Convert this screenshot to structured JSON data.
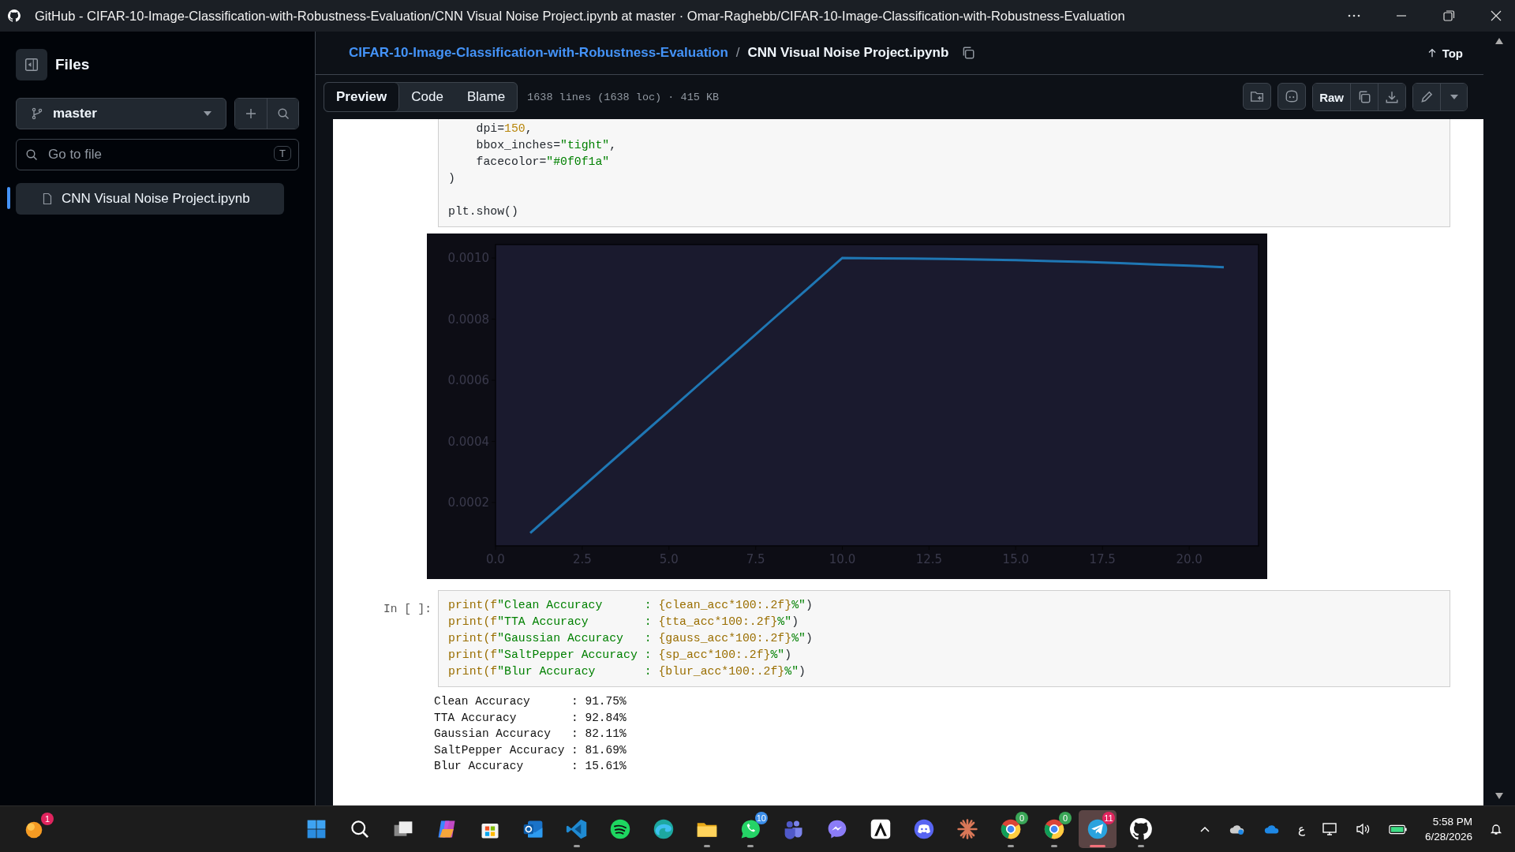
{
  "window": {
    "title": "GitHub - CIFAR-10-Image-Classification-with-Robustness-Evaluation/CNN Visual Noise Project.ipynb at master · Omar-Raghebb/CIFAR-10-Image-Classification-with-Robustness-Evaluation"
  },
  "sidebar": {
    "title": "Files",
    "branch": "master",
    "search": {
      "placeholder": "Go to file",
      "shortcut": "T"
    },
    "items": [
      {
        "label": "CNN Visual Noise Project.ipynb",
        "selected": true
      }
    ]
  },
  "breadcrumb": {
    "repo": "CIFAR-10-Image-Classification-with-Robustness-Evaluation",
    "separator": "/",
    "file": "CNN Visual Noise Project.ipynb",
    "top": "Top"
  },
  "toolbar": {
    "tabs": [
      {
        "label": "Preview",
        "selected": true
      },
      {
        "label": "Code",
        "selected": false
      },
      {
        "label": "Blame",
        "selected": false
      }
    ],
    "info": "1638 lines (1638 loc) · 415 KB",
    "raw": "Raw"
  },
  "cells": [
    {
      "kind": "code",
      "lines": [
        {
          "spans": [
            {
              "kind": "plain",
              "text": "    dpi="
            },
            {
              "kind": "number",
              "text": "150"
            },
            {
              "kind": "plain",
              "text": ","
            }
          ]
        },
        {
          "spans": [
            {
              "kind": "plain",
              "text": "    bbox_inches="
            },
            {
              "kind": "string",
              "text": "\"tight\""
            },
            {
              "kind": "plain",
              "text": ","
            }
          ]
        },
        {
          "spans": [
            {
              "kind": "plain",
              "text": "    facecolor="
            },
            {
              "kind": "string",
              "text": "\"#0f0f1a\""
            }
          ]
        },
        {
          "spans": [
            {
              "kind": "plain",
              "text": ")"
            }
          ]
        },
        {
          "blank_before": true,
          "spans": [
            {
              "kind": "plain",
              "text": "plt.show()"
            }
          ]
        }
      ]
    },
    {
      "kind": "chart",
      "chart_data": {
        "type": "line",
        "x": [
          1,
          2,
          3,
          4,
          5,
          6,
          7,
          8,
          9,
          10,
          11,
          12,
          13,
          14,
          15,
          16,
          17,
          18,
          19,
          20,
          21
        ],
        "series": [
          {
            "color": "#1f77b4",
            "values": [
              0.0001,
              0.0002,
              0.0003,
              0.0004,
              0.0005,
              0.0006,
              0.0007,
              0.0008,
              0.0009,
              0.001,
              0.000999,
              0.000998,
              0.000997,
              0.000995,
              0.000993,
              0.00099,
              0.000987,
              0.000983,
              0.000979,
              0.000975,
              0.00097
            ]
          }
        ],
        "xlim": [
          0,
          22
        ],
        "ylim": [
          5.8e-05,
          0.001044
        ],
        "xticks": [
          {
            "value": 0,
            "label": "0.0"
          },
          {
            "value": 2.5,
            "label": "2.5"
          },
          {
            "value": 5,
            "label": "5.0"
          },
          {
            "value": 7.5,
            "label": "7.5"
          },
          {
            "value": 10,
            "label": "10.0"
          },
          {
            "value": 12.5,
            "label": "12.5"
          },
          {
            "value": 15,
            "label": "15.0"
          },
          {
            "value": 17.5,
            "label": "17.5"
          },
          {
            "value": 20,
            "label": "20.0"
          }
        ],
        "yticks": [
          {
            "value": 0.0002,
            "label": "0.0002"
          },
          {
            "value": 0.0004,
            "label": "0.0004"
          },
          {
            "value": 0.0006,
            "label": "0.0006"
          },
          {
            "value": 0.0008,
            "label": "0.0008"
          },
          {
            "value": 0.001,
            "label": "0.0010"
          }
        ]
      }
    },
    {
      "kind": "code",
      "prompt": "In [ ]:",
      "lines": [
        {
          "spans": [
            {
              "kind": "builtin",
              "text": "print("
            },
            {
              "kind": "builtin",
              "text": "f"
            },
            {
              "kind": "string",
              "text": "\"Clean Accuracy      : "
            },
            {
              "kind": "interp",
              "text": "{clean_acc*100:.2f}"
            },
            {
              "kind": "string",
              "text": "%\""
            },
            {
              "kind": "plain",
              "text": ")"
            }
          ]
        },
        {
          "spans": [
            {
              "kind": "builtin",
              "text": "print("
            },
            {
              "kind": "builtin",
              "text": "f"
            },
            {
              "kind": "string",
              "text": "\"TTA Accuracy        : "
            },
            {
              "kind": "interp",
              "text": "{tta_acc*100:.2f}"
            },
            {
              "kind": "string",
              "text": "%\""
            },
            {
              "kind": "plain",
              "text": ")"
            }
          ]
        },
        {
          "spans": [
            {
              "kind": "builtin",
              "text": "print("
            },
            {
              "kind": "builtin",
              "text": "f"
            },
            {
              "kind": "string",
              "text": "\"Gaussian Accuracy   : "
            },
            {
              "kind": "interp",
              "text": "{gauss_acc*100:.2f}"
            },
            {
              "kind": "string",
              "text": "%\""
            },
            {
              "kind": "plain",
              "text": ")"
            }
          ]
        },
        {
          "spans": [
            {
              "kind": "builtin",
              "text": "print("
            },
            {
              "kind": "builtin",
              "text": "f"
            },
            {
              "kind": "string",
              "text": "\"SaltPepper Accuracy : "
            },
            {
              "kind": "interp",
              "text": "{sp_acc*100:.2f}"
            },
            {
              "kind": "string",
              "text": "%\""
            },
            {
              "kind": "plain",
              "text": ")"
            }
          ]
        },
        {
          "spans": [
            {
              "kind": "builtin",
              "text": "print("
            },
            {
              "kind": "builtin",
              "text": "f"
            },
            {
              "kind": "string",
              "text": "\"Blur Accuracy       : "
            },
            {
              "kind": "interp",
              "text": "{blur_acc*100:.2f}"
            },
            {
              "kind": "string",
              "text": "%\""
            },
            {
              "kind": "plain",
              "text": ")"
            }
          ]
        }
      ]
    },
    {
      "kind": "output",
      "lines": [
        "Clean Accuracy      : 91.75%",
        "TTA Accuracy        : 92.84%",
        "Gaussian Accuracy   : 82.11%",
        "SaltPepper Accuracy : 81.69%",
        "Blur Accuracy       : 15.61%"
      ]
    }
  ],
  "taskbar": {
    "apps": [
      {
        "kind": "windows",
        "running": false,
        "active": false
      },
      {
        "kind": "search",
        "running": false,
        "active": false
      },
      {
        "kind": "taskview",
        "running": false,
        "active": false
      },
      {
        "kind": "swirl",
        "running": false,
        "active": false
      },
      {
        "kind": "store",
        "running": false,
        "active": false
      },
      {
        "kind": "mail",
        "running": false,
        "active": false
      },
      {
        "kind": "code",
        "running": true,
        "active": false
      },
      {
        "kind": "music",
        "running": false,
        "active": false
      },
      {
        "kind": "browser",
        "running": false,
        "active": false
      },
      {
        "kind": "folder",
        "running": true,
        "active": false
      },
      {
        "kind": "chat",
        "badge": "10",
        "running": true,
        "active": false
      },
      {
        "kind": "people",
        "running": false,
        "active": false
      },
      {
        "kind": "bubble",
        "running": false,
        "active": false
      },
      {
        "kind": "triangle",
        "running": false,
        "active": false
      },
      {
        "kind": "gamepad",
        "running": false,
        "active": false
      },
      {
        "kind": "asterisk",
        "running": false,
        "active": false
      },
      {
        "kind": "ring",
        "badge": "0",
        "running": true,
        "active": false
      },
      {
        "kind": "ring",
        "badge": "0",
        "running": true,
        "active": false
      },
      {
        "kind": "plane",
        "badge": "11",
        "running": true,
        "active": true
      },
      {
        "kind": "cat",
        "running": true,
        "active": false
      }
    ],
    "weather_badge": "1",
    "language": "ع",
    "time": "5:58 PM",
    "date": "6/28/2026"
  }
}
